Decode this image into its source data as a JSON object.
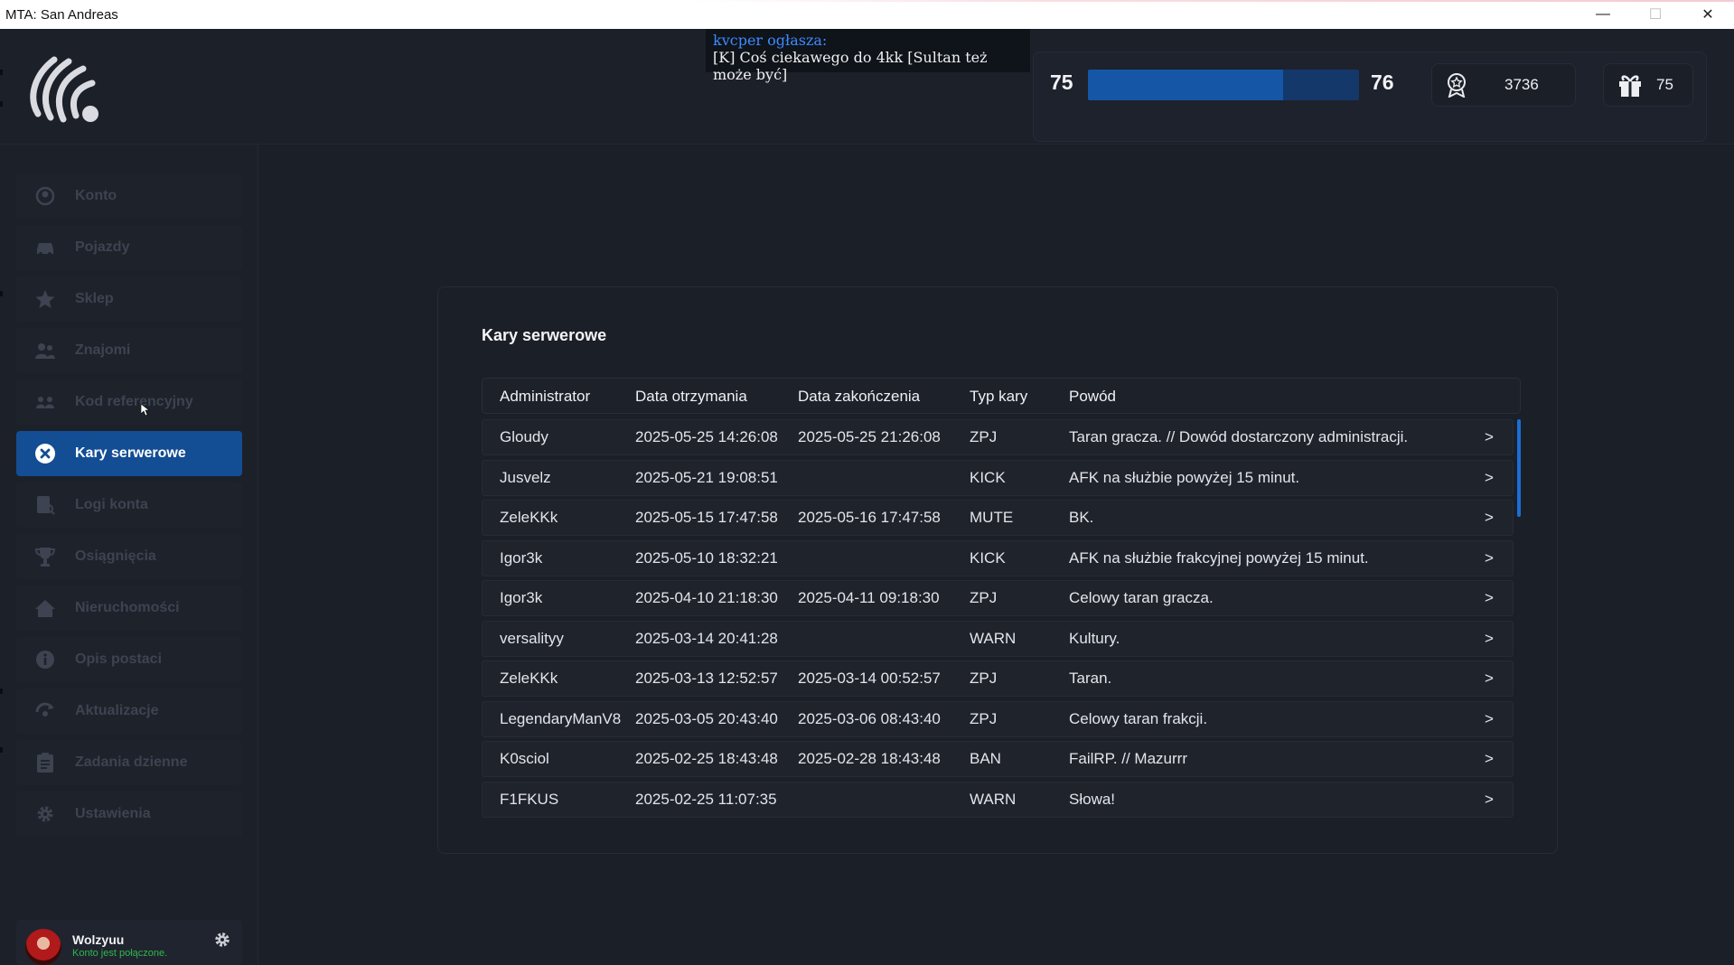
{
  "window": {
    "title": "MTA: San Andreas",
    "minimize": "—",
    "maximize": "☐",
    "close": "✕"
  },
  "announcement": {
    "author": "kvcper ogłasza:",
    "message": "[K] Coś ciekawego do 4kk [Sultan też może być]"
  },
  "stats": {
    "level_current": "75",
    "level_next": "76",
    "xp_progress": 0.72,
    "reputation": "3736",
    "gifts": "75"
  },
  "sidebar": {
    "items": [
      {
        "label": "Konto",
        "icon": "account-icon",
        "active": false
      },
      {
        "label": "Pojazdy",
        "icon": "car-icon",
        "active": false
      },
      {
        "label": "Sklep",
        "icon": "star-icon",
        "active": false
      },
      {
        "label": "Znajomi",
        "icon": "friends-icon",
        "active": false
      },
      {
        "label": "Kod referencyjny",
        "icon": "referral-icon",
        "active": false
      },
      {
        "label": "Kary serwerowe",
        "icon": "close-circle-icon",
        "active": true
      },
      {
        "label": "Logi konta",
        "icon": "logs-icon",
        "active": false
      },
      {
        "label": "Osiągnięcia",
        "icon": "trophy-icon",
        "active": false
      },
      {
        "label": "Nieruchomości",
        "icon": "house-icon",
        "active": false
      },
      {
        "label": "Opis postaci",
        "icon": "info-icon",
        "active": false
      },
      {
        "label": "Aktualizacje",
        "icon": "update-icon",
        "active": false
      },
      {
        "label": "Zadania dzienne",
        "icon": "tasks-icon",
        "active": false
      },
      {
        "label": "Ustawienia",
        "icon": "gear-icon",
        "active": false
      }
    ]
  },
  "user": {
    "name": "Wolzyuu",
    "status": "Konto jest połączone."
  },
  "panel": {
    "title": "Kary serwerowe",
    "columns": [
      "Administrator",
      "Data otrzymania",
      "Data zakończenia",
      "Typ kary",
      "Powód"
    ],
    "rows": [
      [
        "Gloudy",
        "2025-05-25 14:26:08",
        "2025-05-25 21:26:08",
        "ZPJ",
        "Taran gracza. // Dowód dostarczony administracji.",
        ">"
      ],
      [
        "Jusvelz",
        "2025-05-21 19:08:51",
        "",
        "KICK",
        "AFK na służbie powyżej 15 minut.",
        ">"
      ],
      [
        "ZeleKKk",
        "2025-05-15 17:47:58",
        "2025-05-16 17:47:58",
        "MUTE",
        "BK.",
        ">"
      ],
      [
        "Igor3k",
        "2025-05-10 18:32:21",
        "",
        "KICK",
        "AFK na służbie frakcyjnej powyżej 15 minut.",
        ">"
      ],
      [
        "Igor3k",
        "2025-04-10 21:18:30",
        "2025-04-11 09:18:30",
        "ZPJ",
        "Celowy taran gracza.",
        ">"
      ],
      [
        "versalityy",
        "2025-03-14 20:41:28",
        "",
        "WARN",
        "Kultury.",
        ">"
      ],
      [
        "ZeleKKk",
        "2025-03-13 12:52:57",
        "2025-03-14 00:52:57",
        "ZPJ",
        "Taran.",
        ">"
      ],
      [
        "LegendaryManV8",
        "2025-03-05 20:43:40",
        "2025-03-06 08:43:40",
        "ZPJ",
        "Celowy taran frakcji.",
        ">"
      ],
      [
        "K0sciol",
        "2025-02-25 18:43:48",
        "2025-02-28 18:43:48",
        "BAN",
        "FailRP. // Mazurrr",
        ">"
      ],
      [
        "F1FKUS",
        "2025-02-25 11:07:35",
        "",
        "WARN",
        "Słowa!",
        ">"
      ]
    ]
  }
}
